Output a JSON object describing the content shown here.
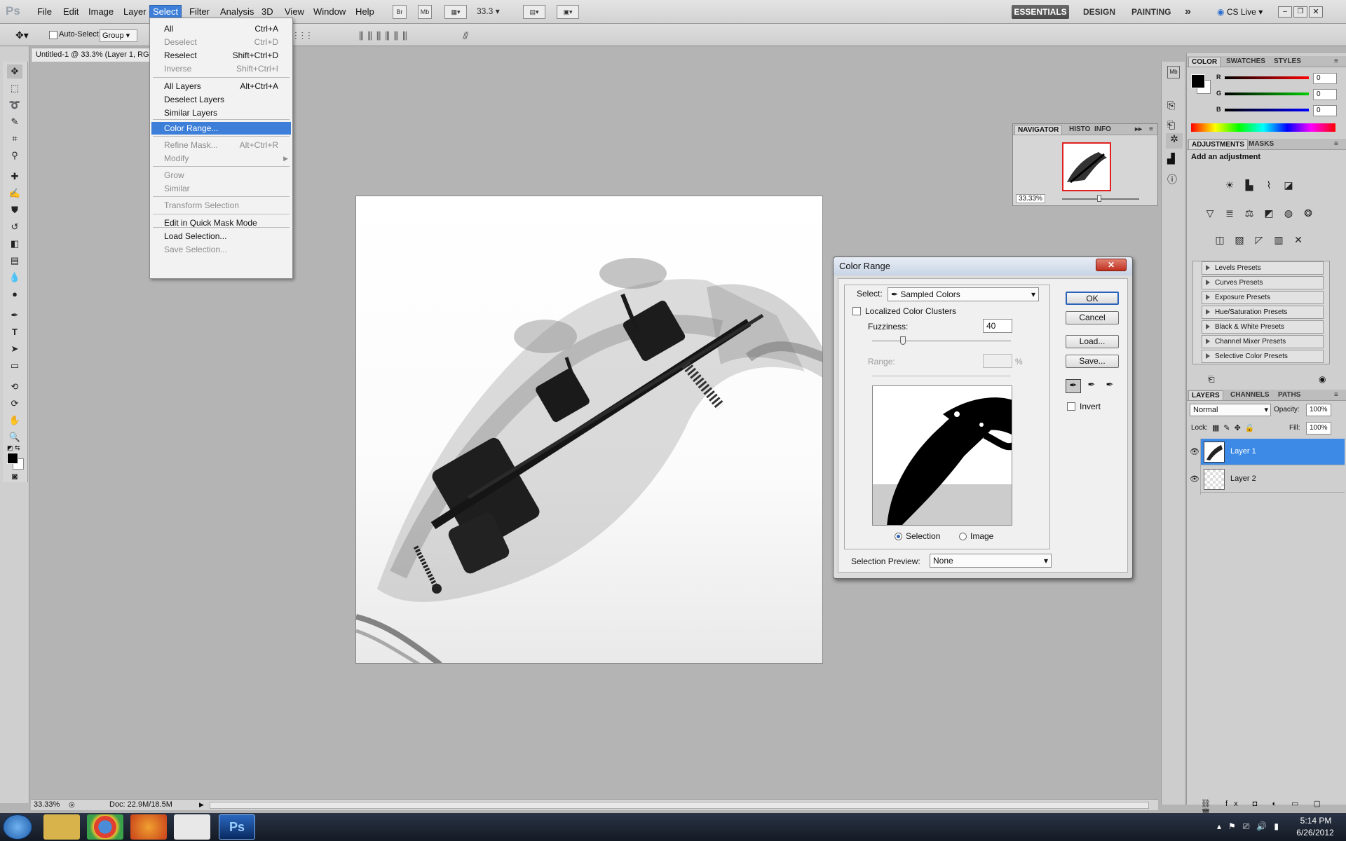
{
  "menubar": {
    "logo": "Ps",
    "items": [
      "File",
      "Edit",
      "Image",
      "Layer",
      "Select",
      "Filter",
      "Analysis",
      "3D",
      "View",
      "Window",
      "Help"
    ],
    "active": "Select",
    "bridge": "Br",
    "minibridge": "Mb",
    "zoom": "33.3",
    "workspaces": [
      "ESSENTIALS",
      "DESIGN",
      "PAINTING"
    ],
    "more": "»",
    "cslive": "CS Live"
  },
  "options": {
    "autoselect": "Auto-Select:",
    "group": "Group"
  },
  "document": {
    "tab_title": "Untitled-1 @ 33.3% (Layer 1, RG",
    "status_zoom": "33.33%",
    "status_doc": "Doc: 22.9M/18.5M"
  },
  "select_menu": [
    {
      "label": "All",
      "shortcut": "Ctrl+A",
      "disabled": false
    },
    {
      "label": "Deselect",
      "shortcut": "Ctrl+D",
      "disabled": true
    },
    {
      "label": "Reselect",
      "shortcut": "Shift+Ctrl+D",
      "disabled": false
    },
    {
      "label": "Inverse",
      "shortcut": "Shift+Ctrl+I",
      "disabled": true
    },
    {
      "label": "All Layers",
      "shortcut": "Alt+Ctrl+A",
      "disabled": false
    },
    {
      "label": "Deselect Layers",
      "shortcut": "",
      "disabled": false
    },
    {
      "label": "Similar Layers",
      "shortcut": "",
      "disabled": false
    },
    {
      "label": "Color Range...",
      "shortcut": "",
      "disabled": false,
      "highlight": true
    },
    {
      "label": "Refine Mask...",
      "shortcut": "Alt+Ctrl+R",
      "disabled": true
    },
    {
      "label": "Modify",
      "shortcut": "",
      "disabled": true,
      "submenu": true
    },
    {
      "label": "Grow",
      "shortcut": "",
      "disabled": true
    },
    {
      "label": "Similar",
      "shortcut": "",
      "disabled": true
    },
    {
      "label": "Transform Selection",
      "shortcut": "",
      "disabled": true
    },
    {
      "label": "Edit in Quick Mask Mode",
      "shortcut": "",
      "disabled": false
    },
    {
      "label": "Load Selection...",
      "shortcut": "",
      "disabled": false
    },
    {
      "label": "Save Selection...",
      "shortcut": "",
      "disabled": true
    }
  ],
  "dialog": {
    "title": "Color Range",
    "close": "✕",
    "select_label": "Select:",
    "select_value": "Sampled Colors",
    "localized": "Localized Color Clusters",
    "fuzziness_label": "Fuzziness:",
    "fuzziness_value": "40",
    "range_label": "Range:",
    "range_unit": "%",
    "radio_selection": "Selection",
    "radio_image": "Image",
    "preview_label": "Selection Preview:",
    "preview_value": "None",
    "ok": "OK",
    "cancel": "Cancel",
    "load": "Load...",
    "save": "Save...",
    "invert": "Invert"
  },
  "navigator": {
    "tabs": [
      "NAVIGATOR",
      "HISTO",
      "INFO"
    ],
    "zoom": "33.33%"
  },
  "color_panel": {
    "tabs": [
      "COLOR",
      "SWATCHES",
      "STYLES"
    ],
    "channels": [
      {
        "name": "R",
        "value": "0"
      },
      {
        "name": "G",
        "value": "0"
      },
      {
        "name": "B",
        "value": "0"
      }
    ]
  },
  "adjustments": {
    "tabs": [
      "ADJUSTMENTS",
      "MASKS"
    ],
    "heading": "Add an adjustment",
    "presets": [
      "Levels Presets",
      "Curves Presets",
      "Exposure Presets",
      "Hue/Saturation Presets",
      "Black & White Presets",
      "Channel Mixer Presets",
      "Selective Color Presets"
    ]
  },
  "layers": {
    "tabs": [
      "LAYERS",
      "CHANNELS",
      "PATHS"
    ],
    "blend": "Normal",
    "opacity_label": "Opacity:",
    "opacity": "100%",
    "lock_label": "Lock:",
    "fill_label": "Fill:",
    "fill": "100%",
    "items": [
      {
        "name": "Layer 1",
        "selected": true
      },
      {
        "name": "Layer 2",
        "selected": false
      }
    ]
  },
  "taskbar": {
    "time": "5:14 PM",
    "date": "6/26/2012"
  }
}
